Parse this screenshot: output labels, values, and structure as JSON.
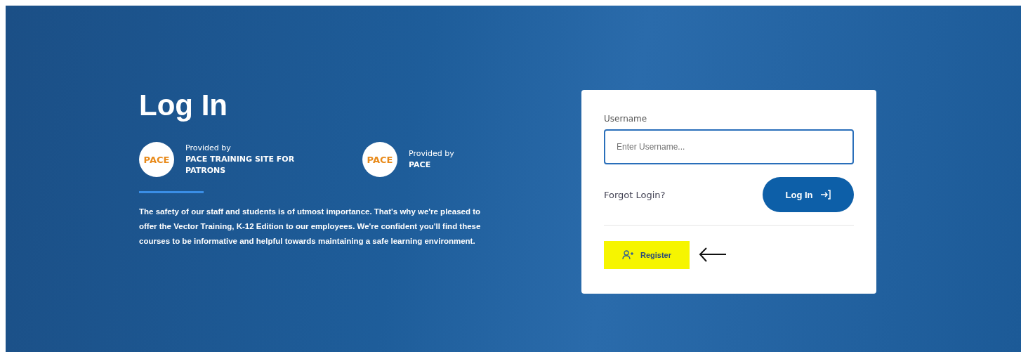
{
  "heading": "Log In",
  "providers": [
    {
      "logo": "PACE",
      "label": "Provided by",
      "name": "PACE TRAINING SITE FOR PATRONS"
    },
    {
      "logo": "PACE",
      "label": "Provided by",
      "name": "PACE"
    }
  ],
  "description": "The safety of our staff and students is of utmost importance. That's why we're pleased to offer the Vector Training, K-12 Edition to our employees. We're confident you'll find these courses to be informative and helpful towards maintaining a safe learning environment.",
  "login_form": {
    "username_label": "Username",
    "username_placeholder": "Enter Username...",
    "forgot_link": "Forgot Login?",
    "login_button": "Log In",
    "register_button": "Register",
    "register_highlighted": true
  }
}
